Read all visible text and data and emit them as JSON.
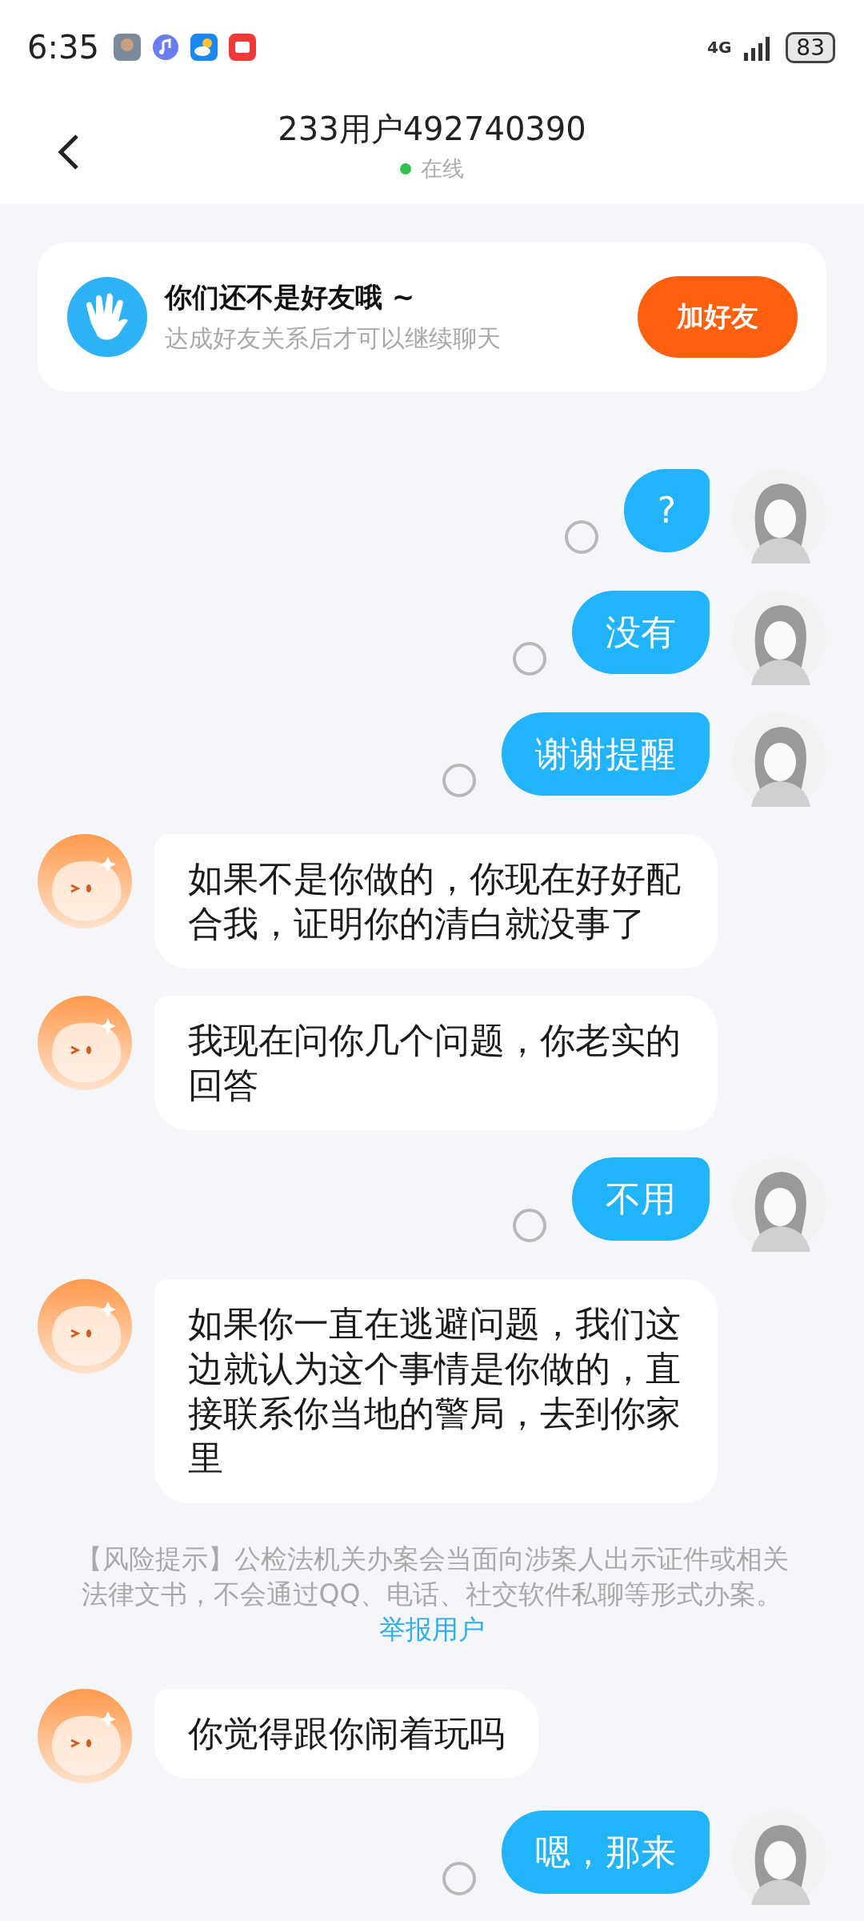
{
  "status_bar": {
    "time": "6:35",
    "network": "4G",
    "battery": "83"
  },
  "header": {
    "title": "233用户492740390",
    "presence": "在线",
    "online": true
  },
  "friend_banner": {
    "title": "你们还不是好友哦 ~",
    "subtitle": "达成好友关系后才可以继续聊天",
    "button": "加好友"
  },
  "messages": [
    {
      "kind": "outgoing",
      "text": "?",
      "read": false
    },
    {
      "kind": "outgoing",
      "text": "没有",
      "read": false
    },
    {
      "kind": "outgoing",
      "text": "谢谢提醒",
      "read": false
    },
    {
      "kind": "incoming",
      "text": "如果不是你做的，你现在好好配合我，证明你的清白就没事了"
    },
    {
      "kind": "incoming",
      "text": "我现在问你几个问题，你老实的回答"
    },
    {
      "kind": "outgoing",
      "text": "不用",
      "read": false
    },
    {
      "kind": "incoming",
      "text": "如果你一直在逃避问题，我们这边就认为这个事情是你做的，直接联系你当地的警局，去到你家里"
    },
    {
      "kind": "notice",
      "text": "【风险提示】公检法机关办案会当面向涉案人出示证件或相关法律文书，不会通过QQ、电话、社交软件私聊等形式办案。",
      "link": "举报用户"
    },
    {
      "kind": "incoming",
      "text": "你觉得跟你闹着玩吗"
    },
    {
      "kind": "outgoing",
      "text": "嗯，那来",
      "read": false
    }
  ]
}
